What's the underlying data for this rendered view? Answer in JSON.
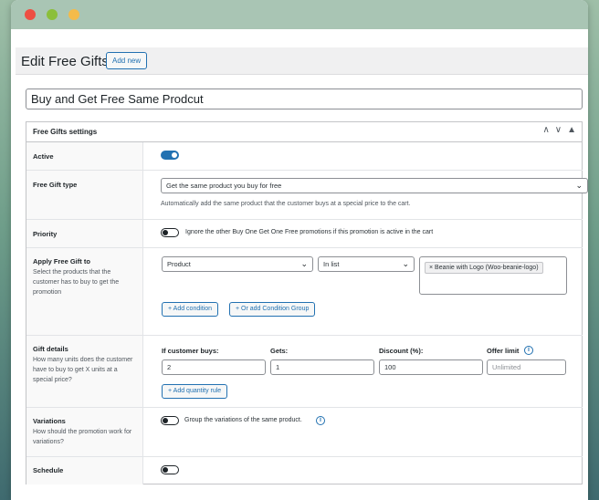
{
  "page": {
    "title": "Edit Free Gifts",
    "add_new_label": "Add new",
    "post_title": "Buy and Get Free Same Prodcut"
  },
  "box": {
    "title": "Free Gifts settings",
    "controls": [
      "∧",
      "∨",
      "▲"
    ]
  },
  "rows": {
    "active": {
      "label": "Active",
      "enabled": true
    },
    "gift_type": {
      "label": "Free Gift type",
      "selected": "Get the same product you buy for free",
      "help": "Automatically add the same product that the customer buys at a special price to the cart."
    },
    "priority": {
      "label": "Priority",
      "toggle_text": "Ignore the other Buy One Get One Free promotions if this promotion is active in the cart",
      "enabled": false
    },
    "apply_to": {
      "label": "Apply Free Gift to",
      "description": "Select the products that the customer has to buy to get the promotion",
      "condition_type": "Product",
      "condition_operator": "In list",
      "tag": "× Beanie with Logo (Woo-beanie-logo)",
      "add_condition": "+ Add condition",
      "add_group": "+ Or add Condition Group"
    },
    "gift_details": {
      "label": "Gift details",
      "description": "How many units does the customer have to buy to get X units at a special price?",
      "col_buys": "If customer buys:",
      "col_gets": "Gets:",
      "col_discount": "Discount (%):",
      "col_limit": "Offer limit",
      "buys": "2",
      "gets": "1",
      "discount": "100",
      "limit_placeholder": "Unlimited",
      "add_rule": "+ Add quantity rule"
    },
    "variations": {
      "label": "Variations",
      "description": "How should the promotion work for variations?",
      "toggle_text": "Group the variations of the same product.",
      "enabled": false
    },
    "schedule": {
      "label": "Schedule",
      "enabled": false
    }
  },
  "icons": {
    "info": "i",
    "chevron": "⌄"
  },
  "colors": {
    "accent": "#2271b1",
    "titlebar": "#a9c5b4"
  }
}
